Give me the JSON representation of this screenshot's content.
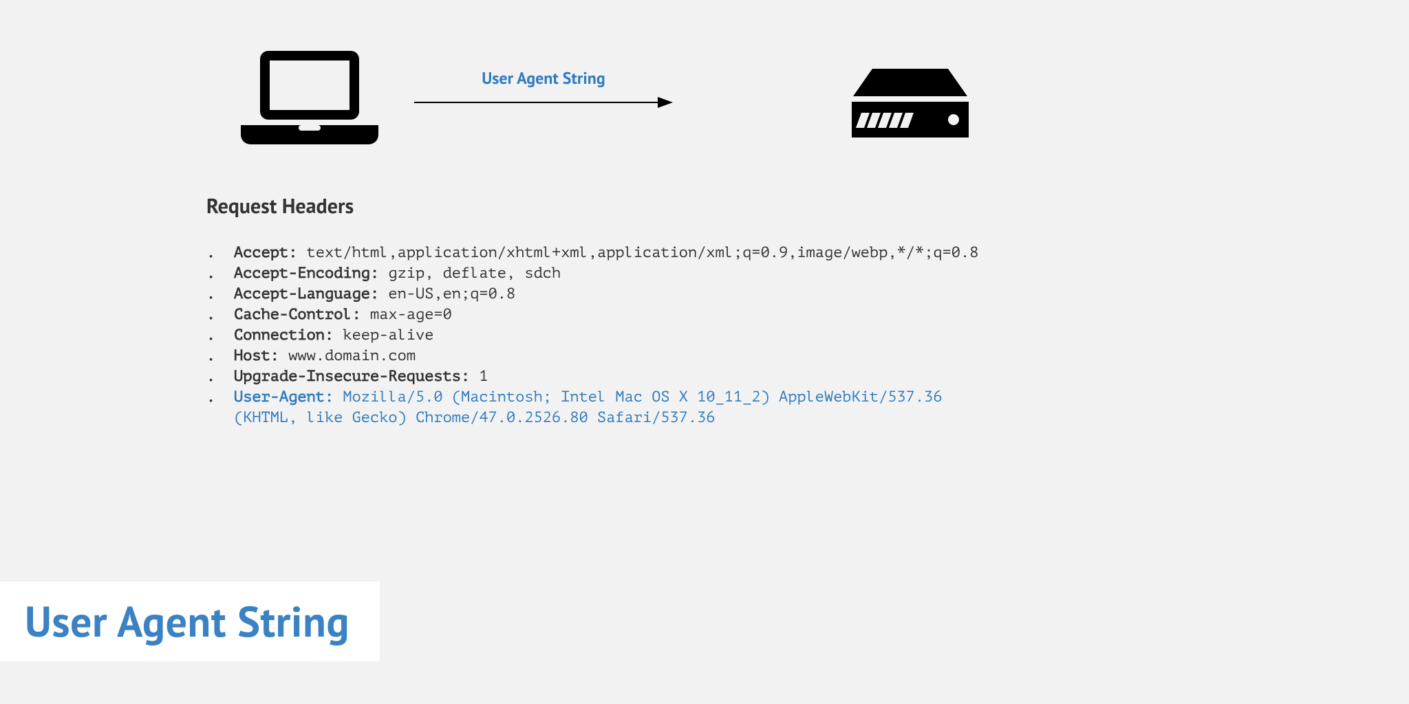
{
  "diagram": {
    "arrow_label": "User Agent String"
  },
  "section_title": "Request Headers",
  "headers": [
    {
      "name": "Accept:",
      "value": " text/html,application/xhtml+xml,application/xml;q=0.9,image/webp,*/*;q=0.8",
      "highlight": false
    },
    {
      "name": "Accept-Encoding:",
      "value": " gzip, deflate, sdch",
      "highlight": false
    },
    {
      "name": "Accept-Language:",
      "value": " en-US,en;q=0.8",
      "highlight": false
    },
    {
      "name": "Cache-Control:",
      "value": " max-age=0",
      "highlight": false
    },
    {
      "name": "Connection:",
      "value": " keep-alive",
      "highlight": false
    },
    {
      "name": "Host:",
      "value": " www.domain.com",
      "highlight": false
    },
    {
      "name": "Upgrade-Insecure-Requests:",
      "value": " 1",
      "highlight": false
    },
    {
      "name": "User-Agent:",
      "value": " Mozilla/5.0 (Macintosh; Intel Mac OS X 10_11_2) AppleWebKit/537.36",
      "highlight": true,
      "cont": "(KHTML, like Gecko) Chrome/47.0.2526.80 Safari/537.36"
    }
  ],
  "slide_title": "User Agent String"
}
